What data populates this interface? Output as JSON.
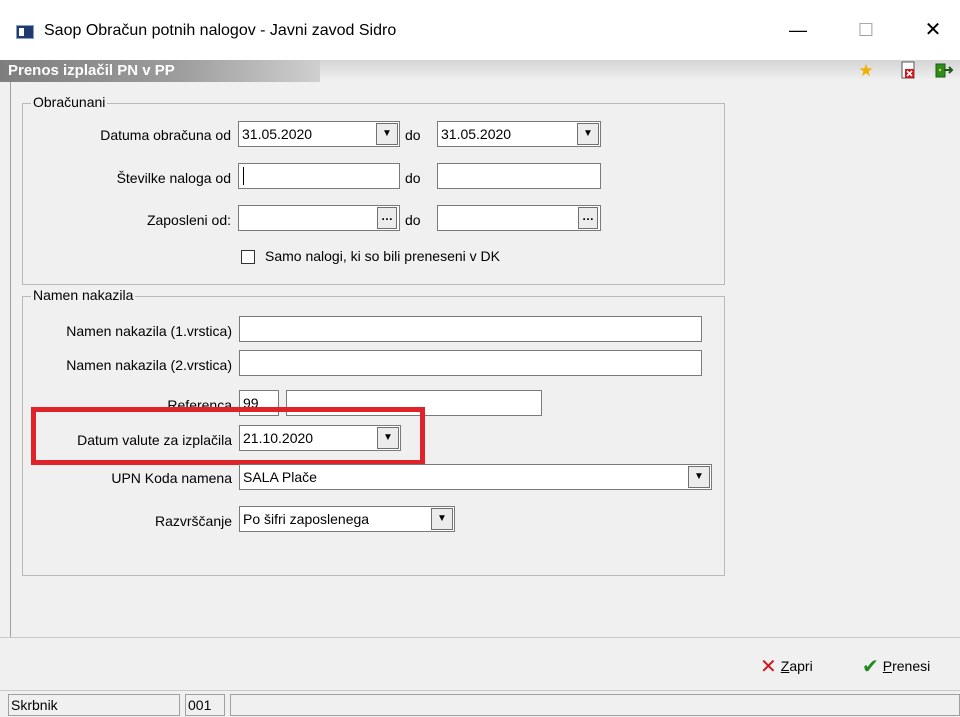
{
  "window": {
    "title": "Saop Obračun potnih nalogov - Javni zavod Sidro",
    "minimize": "—",
    "maximize": "☐",
    "close": "✕"
  },
  "header": {
    "title": "Prenos izplačil PN v PP",
    "icons": [
      "star-icon",
      "document-close-icon",
      "exit-icon"
    ]
  },
  "obracunani": {
    "caption": "Obračunani",
    "datum_label": "Datuma obračuna od",
    "datum_from": "31.05.2020",
    "datum_to": "31.05.2020",
    "do_label": "do",
    "stevilke_label": "Številke naloga od",
    "stevilke_from": "",
    "stevilke_to": "",
    "zaposleni_label": "Zaposleni od:",
    "zaposleni_from": "",
    "zaposleni_to": "",
    "checkbox_label": "Samo nalogi, ki so bili preneseni v DK",
    "checkbox_checked": false
  },
  "namen": {
    "caption": "Namen nakazila",
    "vrstica1_label": "Namen nakazila (1.vrstica)",
    "vrstica1_value": "",
    "vrstica2_label": "Namen nakazila (2.vrstica)",
    "vrstica2_value": "",
    "referenca_label": "Referenca",
    "referenca_model": "99",
    "referenca_value": "",
    "datum_valute_label": "Datum valute za izplačila",
    "datum_valute_value": "21.10.2020",
    "upn_label": "UPN Koda namena",
    "upn_value": "SALA Plače",
    "razvrscanje_label": "Razvrščanje",
    "razvrscanje_value": "Po šifri zaposlenega"
  },
  "actions": {
    "zapri_first": "Z",
    "zapri_rest": "apri",
    "prenesi_first": "P",
    "prenesi_rest": "renesi"
  },
  "status": {
    "user": "Skrbnik",
    "code": "001",
    "extra": ""
  },
  "colors": {
    "highlight": "#e0222a",
    "header_gradient": "#8a8a8a"
  }
}
